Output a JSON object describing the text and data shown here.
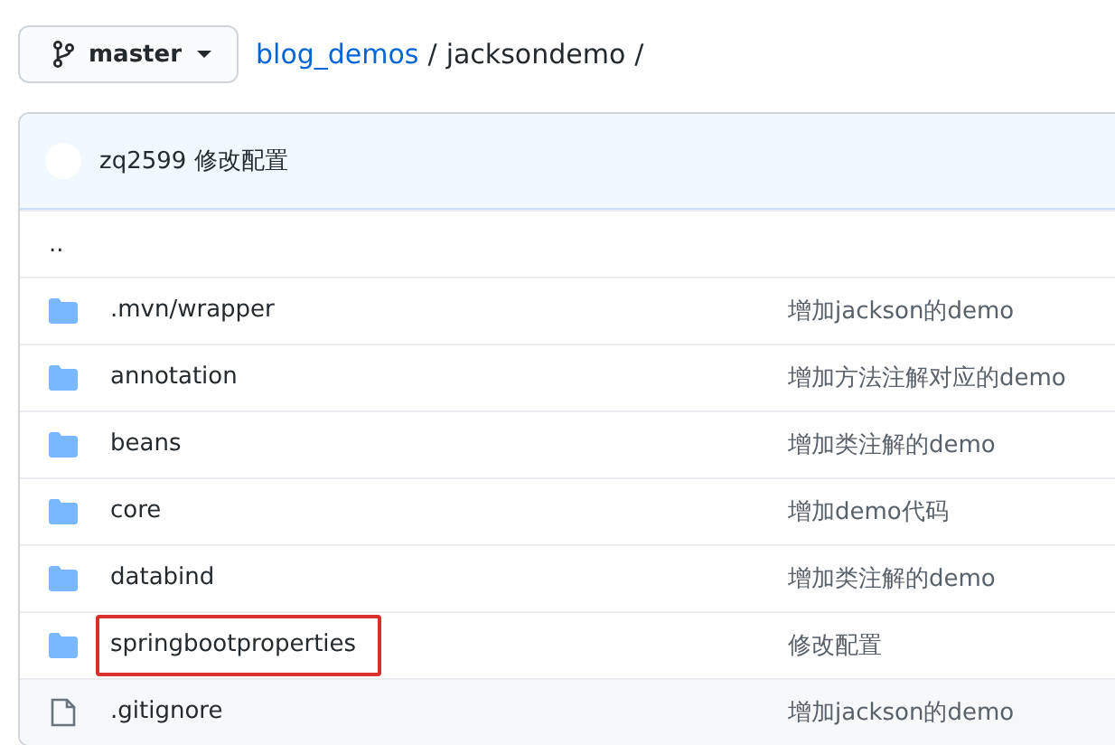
{
  "branch": {
    "name": "master"
  },
  "breadcrumb": {
    "repo": "blog_demos",
    "separator_1": "/",
    "folder": "jacksondemo",
    "separator_2": "/"
  },
  "commit": {
    "text": "zq2599 修改配置"
  },
  "parent_link": "..",
  "files": [
    {
      "kind": "folder",
      "name": ".mvn/wrapper",
      "message": "增加jackson的demo",
      "highlighted": false
    },
    {
      "kind": "folder",
      "name": "annotation",
      "message": "增加方法注解对应的demo",
      "highlighted": false
    },
    {
      "kind": "folder",
      "name": "beans",
      "message": "增加类注解的demo",
      "highlighted": false
    },
    {
      "kind": "folder",
      "name": "core",
      "message": "增加demo代码",
      "highlighted": false
    },
    {
      "kind": "folder",
      "name": "databind",
      "message": "增加类注解的demo",
      "highlighted": false
    },
    {
      "kind": "folder",
      "name": "springbootproperties",
      "message": "修改配置",
      "highlighted": true
    },
    {
      "kind": "file",
      "name": ".gitignore",
      "message": "增加jackson的demo",
      "highlighted": false
    }
  ]
}
